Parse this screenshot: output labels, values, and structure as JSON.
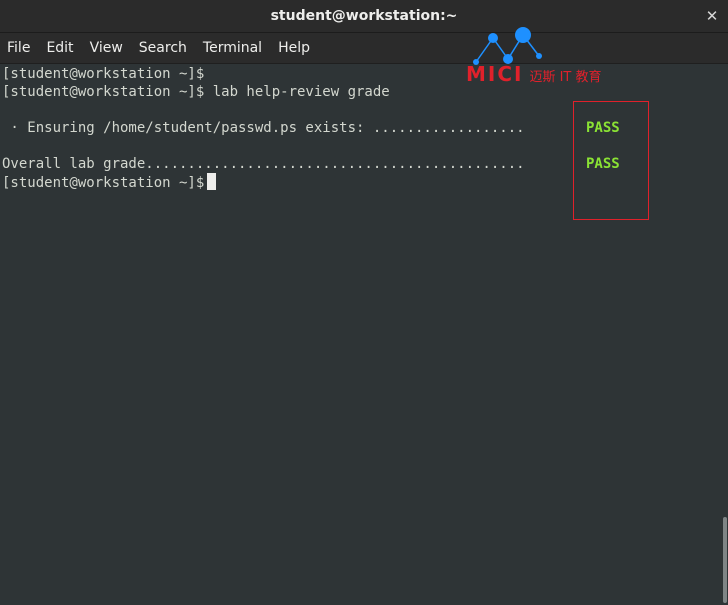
{
  "window": {
    "title": "student@workstation:~",
    "close_glyph": "✕"
  },
  "menu": {
    "items": [
      "File",
      "Edit",
      "View",
      "Search",
      "Terminal",
      "Help"
    ]
  },
  "terminal": {
    "lines": [
      "[student@workstation ~]$",
      "[student@workstation ~]$ lab help-review grade",
      "",
      " · Ensuring /home/student/passwd.ps exists: ..................",
      "",
      "Overall lab grade.............................................",
      "[student@workstation ~]$"
    ],
    "results": [
      {
        "line": 3,
        "text": "PASS"
      },
      {
        "line": 5,
        "text": "PASS"
      }
    ],
    "colors": {
      "background": "#2e3436",
      "foreground": "#d3d7cf",
      "pass": "#8ae234",
      "highlight_box": "#e0212b"
    }
  },
  "watermark": {
    "brand": "MICI",
    "subtitle": "迈斯 IT 教育",
    "color": "#e0212b",
    "node_color": "#1e90ff"
  }
}
